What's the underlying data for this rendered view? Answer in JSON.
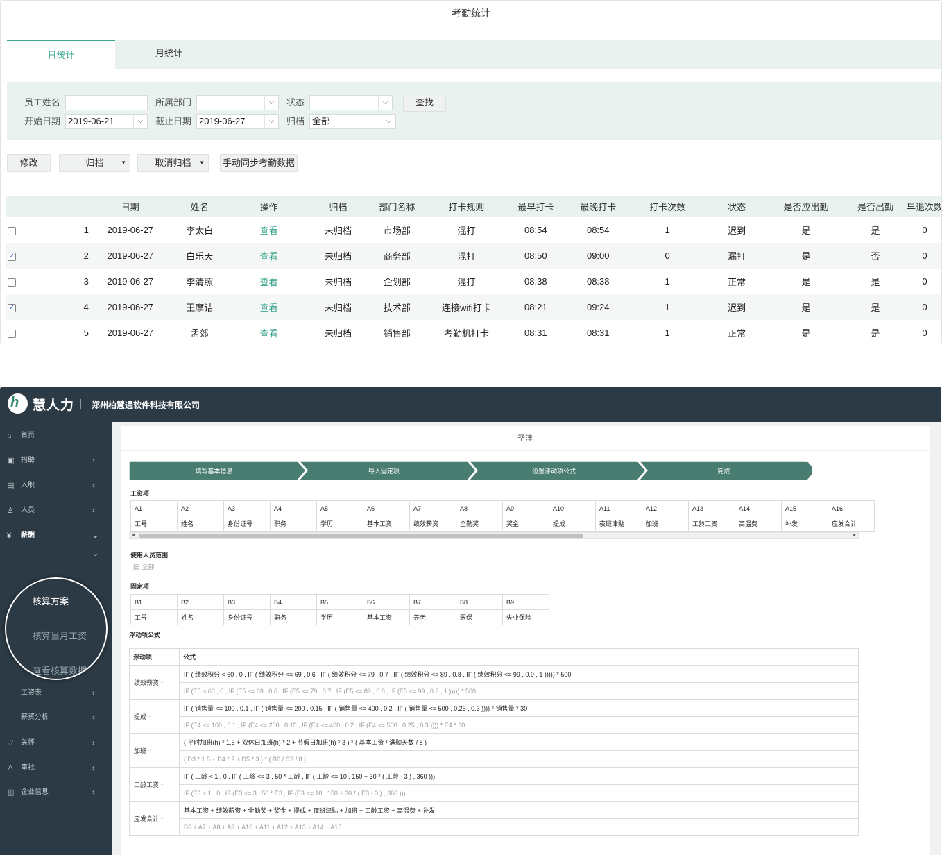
{
  "attendance": {
    "title": "考勤统计",
    "tabs": [
      {
        "label": "日统计",
        "active": true
      },
      {
        "label": "月统计",
        "active": false
      }
    ],
    "filters": {
      "name_label": "员工姓名",
      "name_value": "",
      "dept_label": "所属部门",
      "dept_value": "",
      "status_label": "状态",
      "status_value": "",
      "search_label": "查找",
      "start_label": "开始日期",
      "start_value": "2019-06-21",
      "end_label": "截止日期",
      "end_value": "2019-06-27",
      "archive_label": "归档",
      "archive_value": "全部"
    },
    "actions": {
      "edit": "修改",
      "archive": "归档",
      "unarchive": "取消归档",
      "sync": "手动同步考勤数据"
    },
    "columns": [
      "日期",
      "姓名",
      "操作",
      "归档",
      "部门名称",
      "打卡规则",
      "最早打卡",
      "最晚打卡",
      "打卡次数",
      "状态",
      "是否应出勤",
      "是否出勤",
      "早退次数"
    ],
    "rows": [
      {
        "checked": false,
        "no": "1",
        "date": "2019-06-27",
        "name": "李太白",
        "op": "查看",
        "archive": "未归档",
        "dept": "市场部",
        "rule": "混打",
        "earliest": "08:54",
        "latest": "08:54",
        "count": "1",
        "status": "迟到",
        "should": "是",
        "attended": "是",
        "early": "0"
      },
      {
        "checked": true,
        "no": "2",
        "date": "2019-06-27",
        "name": "白乐天",
        "op": "查看",
        "archive": "未归档",
        "dept": "商务部",
        "rule": "混打",
        "earliest": "08:50",
        "latest": "09:00",
        "count": "0",
        "status": "漏打",
        "should": "是",
        "attended": "否",
        "early": "0"
      },
      {
        "checked": false,
        "no": "3",
        "date": "2019-06-27",
        "name": "李清照",
        "op": "查看",
        "archive": "未归档",
        "dept": "企划部",
        "rule": "混打",
        "earliest": "08:38",
        "latest": "08:38",
        "count": "1",
        "status": "正常",
        "should": "是",
        "attended": "是",
        "early": "0"
      },
      {
        "checked": true,
        "no": "4",
        "date": "2019-06-27",
        "name": "王摩诘",
        "op": "查看",
        "archive": "未归档",
        "dept": "技术部",
        "rule": "连接wifi打卡",
        "earliest": "08:21",
        "latest": "09:24",
        "count": "1",
        "status": "迟到",
        "should": "是",
        "attended": "是",
        "early": "0"
      },
      {
        "checked": false,
        "no": "5",
        "date": "2019-06-27",
        "name": "孟郊",
        "op": "查看",
        "archive": "未归档",
        "dept": "销售部",
        "rule": "考勤机打卡",
        "earliest": "08:31",
        "latest": "08:31",
        "count": "1",
        "status": "正常",
        "should": "是",
        "attended": "是",
        "early": "0"
      }
    ]
  },
  "payroll": {
    "brand": {
      "logo_glyph": "h",
      "name": "慧人力",
      "company": "郑州柏慧通软件科技有限公司"
    },
    "sidebar": [
      {
        "icon": "home-icon",
        "glyph": "⌂",
        "label": "首页",
        "chevron": ""
      },
      {
        "icon": "recruit-icon",
        "glyph": "▣",
        "label": "招聘",
        "chevron": "›"
      },
      {
        "icon": "onboard-icon",
        "glyph": "▤",
        "label": "入职",
        "chevron": "›"
      },
      {
        "icon": "people-icon",
        "glyph": "♙",
        "label": "人员",
        "chevron": "›"
      },
      {
        "icon": "salary-icon",
        "glyph": "¥",
        "label": "薪酬",
        "chevron": "⌄"
      }
    ],
    "sidebar_sub": [
      {
        "label": "工资表",
        "chevron": "›"
      },
      {
        "label": "薪资分析",
        "chevron": "›"
      }
    ],
    "sidebar_bottom": [
      {
        "icon": "care-icon",
        "glyph": "♡",
        "label": "关怀",
        "chevron": "›"
      },
      {
        "icon": "approve-icon",
        "glyph": "♙",
        "label": "审批",
        "chevron": "›"
      },
      {
        "icon": "company-icon",
        "glyph": "▥",
        "label": "企业信息",
        "chevron": "›"
      }
    ],
    "magnifier": {
      "item1": "核算方案",
      "item2": "核算当月工资",
      "item3": "查看核算数据"
    },
    "page_title": "圣沣",
    "steps": [
      "填写基本信息",
      "导入固定项",
      "设置浮动项公式",
      "完成"
    ],
    "salary_section": "工资项",
    "salary_codes": [
      "A1",
      "A2",
      "A3",
      "A4",
      "A5",
      "A6",
      "A7",
      "A8",
      "A9",
      "A10",
      "A11",
      "A12",
      "A13",
      "A14",
      "A15",
      "A16"
    ],
    "salary_names": [
      "工号",
      "姓名",
      "身份证号",
      "职务",
      "学历",
      "基本工资",
      "绩效薪资",
      "全勤奖",
      "奖金",
      "提成",
      "夜班津贴",
      "加班",
      "工龄工资",
      "高温费",
      "补发",
      "应发合计"
    ],
    "scope_section": "使用人员范围",
    "scope_value": "全部",
    "fixed_section": "固定项",
    "fixed_codes": [
      "B1",
      "B2",
      "B3",
      "B4",
      "B5",
      "B6",
      "B7",
      "B8",
      "B9"
    ],
    "fixed_names": [
      "工号",
      "姓名",
      "身份证号",
      "职务",
      "学历",
      "基本工资",
      "养老",
      "医保",
      "失业保险"
    ],
    "float_section": "浮动项公式",
    "float_headers": {
      "item": "浮动项",
      "formula": "公式"
    },
    "formulas": [
      {
        "key": "绩效薪资 =",
        "text": "IF ( 绩效积分 < 60 , 0 , IF ( 绩效积分 <= 69 , 0.6 , IF ( 绩效积分 <= 79 , 0.7 , IF ( 绩效积分 <= 89 , 0.8 , IF ( 绩效积分 <= 99 , 0.9 , 1 ))))) * 500",
        "code": "IF (E5 < 60 , 0 , IF (E5 <= 69 , 0.6 , IF (E5 <= 79 , 0.7 , IF (E5 <= 89 , 0.8 , IF (E5 <= 99 , 0.9 , 1 ))))) * 500"
      },
      {
        "key": "提成 =",
        "text": "IF ( 销售量 <= 100 , 0.1 , IF ( 销售量 <= 200 , 0.15 , IF ( 销售量 <= 400 , 0.2 , IF ( 销售量 <= 500 , 0.25 , 0.3 )))) * 销售量 * 30",
        "code": "IF (E4 <= 100 , 0.1 , IF (E4 <= 200 , 0.15 , IF (E4 <= 400 , 0.2 , IF (E4 <= 500 , 0.25 , 0.3 )))) * E4 * 30"
      },
      {
        "key": "加班 =",
        "text": "( 平时加班(h) * 1.5 + 双休日加班(h) * 2 + 节假日加班(h) * 3 ) * ( 基本工资 / 满勤天数 / 8 )",
        "code": "( D3 * 1.5 + D4 * 2 + D5 * 3 ) * ( B6 / C3 / 8 )"
      },
      {
        "key": "工龄工资 =",
        "text": "IF ( 工龄 < 1 , 0 , IF ( 工龄 <= 3 , 50 * 工龄 , IF ( 工龄 <= 10 , 150 + 30 * ( 工龄 - 3 ) , 360 )))",
        "code": "IF (E3 < 1 , 0 , IF (E3 <= 3 , 50 * E3 , IF (E3 <= 10 , 150 + 30 * ( E3 - 3 ) , 360 )))"
      },
      {
        "key": "应发合计 =",
        "text": "基本工资 + 绩效薪资 + 全勤奖 + 奖金 + 提成 + 夜班津贴 + 加班 + 工龄工资 + 高温费 + 补发",
        "code": "B6 + A7 + A8 + A9 + A10 + A11 + A12 + A13 + A14 + A15"
      }
    ]
  }
}
